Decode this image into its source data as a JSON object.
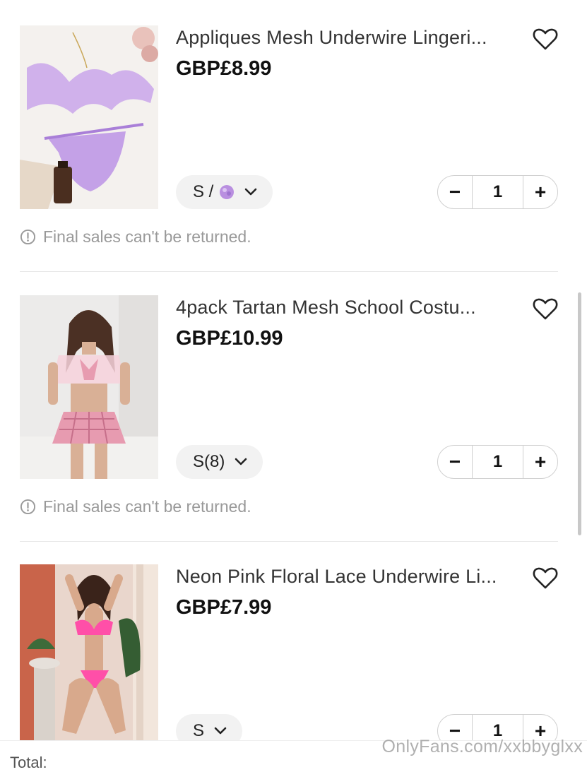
{
  "items": [
    {
      "title": "Appliques Mesh Underwire Lingeri...",
      "price": "GBP£8.99",
      "size": "S /",
      "quantity": "1",
      "decrement": "−",
      "increment": "+",
      "notice": "Final sales can't be returned.",
      "image_desc": "lavender-lingerie-set-photo",
      "accent": "#b58ae0"
    },
    {
      "title": "4pack Tartan Mesh School Costu...",
      "price": "GBP£10.99",
      "size": "S(8)",
      "quantity": "1",
      "decrement": "−",
      "increment": "+",
      "notice": "Final sales can't be returned.",
      "image_desc": "pink-tartan-costume-photo",
      "accent": "#e79bb0"
    },
    {
      "title": "Neon Pink Floral Lace Underwire Li...",
      "price": "GBP£7.99",
      "size": "S",
      "quantity": "1",
      "decrement": "−",
      "increment": "+",
      "image_desc": "neon-pink-lace-lingerie-photo",
      "accent": "#ff4fa8"
    }
  ],
  "footer": {
    "total_label": "Total:"
  },
  "watermark": "OnlyFans.com/xxbbyglxx"
}
